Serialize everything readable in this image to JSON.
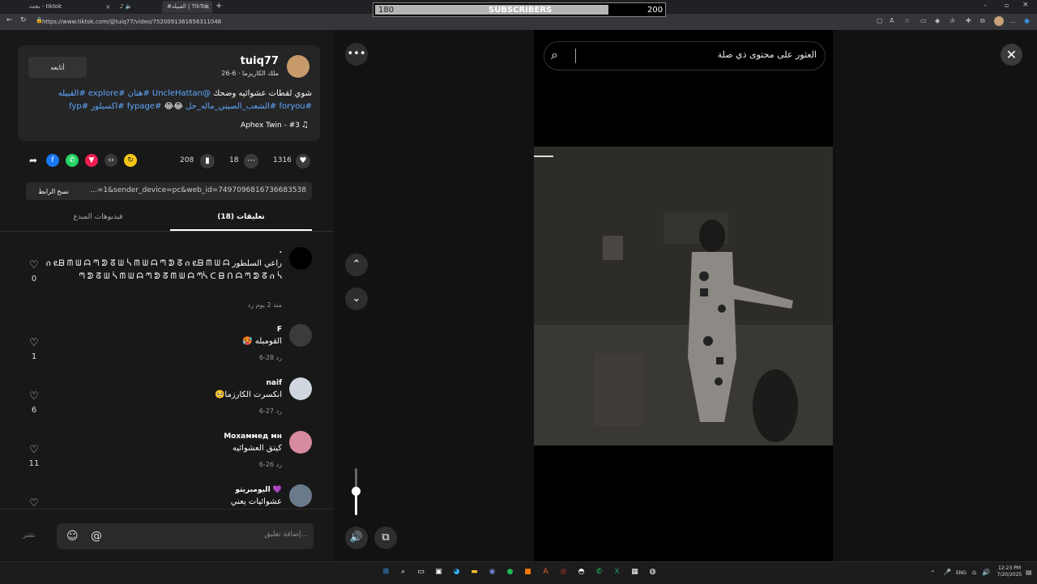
{
  "browser": {
    "tabs": [
      {
        "title": "بحث - tiktok"
      },
      {
        "title": "tiktok"
      },
      {
        "title": "#القبيله | TikTok"
      }
    ],
    "url": "https://www.tiktok.com/@tuiq77/video/7520091361656311048"
  },
  "overlay": {
    "current": "180",
    "label": "SUBSCRIBERS",
    "goal": "200",
    "progress_fraction": 0.9
  },
  "post": {
    "username": "tuiq77",
    "subline": "ملك الكاريزما · 6-26",
    "follow_label": "أتابعه",
    "desc_line1_text": "شوي لقطات عشوائيه وضحك",
    "desc_line1_mention": "@UncleHattan",
    "desc_line1_tags": "#هتان #explore #القبيله",
    "desc_line2_tags": "#foryou #الشعب_الصيني_ماله_حل",
    "desc_line2_emoji": "😂😂",
    "desc_line2_tags2": "#fypage #اكسبلور #fyp",
    "music": "Aphex Twin - #3",
    "likes": "1316",
    "comments": "18",
    "saves": "208",
    "link_text": "...=1&sender_device=pc&web_id=7497096816736683538",
    "copy_label": "نسخ الرابط"
  },
  "tabs": {
    "comments": "تعليقات (18)",
    "creator": "فيديوهات المبدع"
  },
  "comments": [
    {
      "name": ".",
      "text": "راعي السلطور ሰ ዪᗷ ᗰ ᗯ ᗩ ᘉ ᕲ ᘔ ᗯ ᓵ ᗰ ᗯ ᗩ ᘉ ᕲ ᘔ ሰ ዪᗷ ᗰ ᗯ ᗩ ᘉ ᕲ ᘔ ᗯ ᓵ ᗰ ᗯ ᗩ ᘉ ᕲ ᘔ ᗰ ᗯ ᗩ ᘉᓵ ᑕ ᗷ ᑎ ᗩ ᘉ ᕲ ᘔ ሰ ᓵ",
      "meta": "منذ 2 يوم    رد",
      "likes": "0"
    },
    {
      "name": "F",
      "text": "القومبله 🥵",
      "meta": "6-28      رد",
      "likes": "1"
    },
    {
      "name": "naif",
      "text": "انكسرت الكارزما🥺",
      "meta": "6-27      رد",
      "likes": "6"
    },
    {
      "name": "Мохаммед мн",
      "text": "كيتق العشوائيه",
      "meta": "6-26      رد",
      "likes": "11"
    },
    {
      "name": "اليومبريتو 💜",
      "text": "عشوائيات يعني",
      "meta": "",
      "likes": ""
    }
  ],
  "comment_input": {
    "placeholder": "إضافة تعليق...",
    "post_label": "نشر"
  },
  "search": {
    "text": "العثور على محتوى ذي صلة"
  },
  "clock": {
    "time": "12:23 PM",
    "date": "7/20/2025"
  },
  "tray": {
    "lang": "ENG"
  },
  "icons": {
    "more": "more-icon",
    "up": "chevron-up-icon",
    "down": "chevron-down-icon",
    "volume": "volume-icon",
    "pip": "pip-icon",
    "close": "close-icon",
    "search": "search-icon",
    "heart": "heart-icon",
    "comment": "comment-icon",
    "bookmark": "bookmark-icon"
  }
}
